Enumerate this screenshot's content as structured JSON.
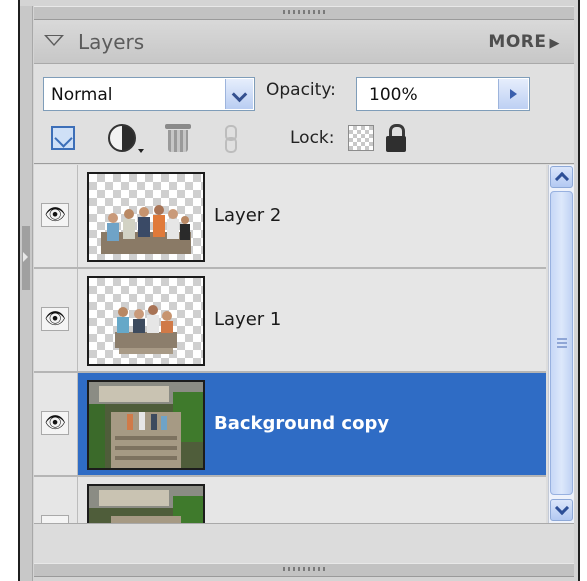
{
  "panel": {
    "title": "Layers",
    "more_label": "MORE",
    "more_arrow": "▶"
  },
  "controls": {
    "blend_mode": "Normal",
    "opacity_label": "Opacity:",
    "opacity_value": "100%",
    "lock_label": "Lock:"
  },
  "icons": {
    "eye": "👁"
  },
  "layers": [
    {
      "name": "Layer 2",
      "visible": true,
      "selected": false
    },
    {
      "name": "Layer 1",
      "visible": true,
      "selected": false
    },
    {
      "name": "Background copy",
      "visible": true,
      "selected": true
    },
    {
      "name": "",
      "visible": false,
      "selected": false
    }
  ],
  "colors": {
    "selection": "#2f6cc5",
    "panel_bg": "#dddddd"
  }
}
